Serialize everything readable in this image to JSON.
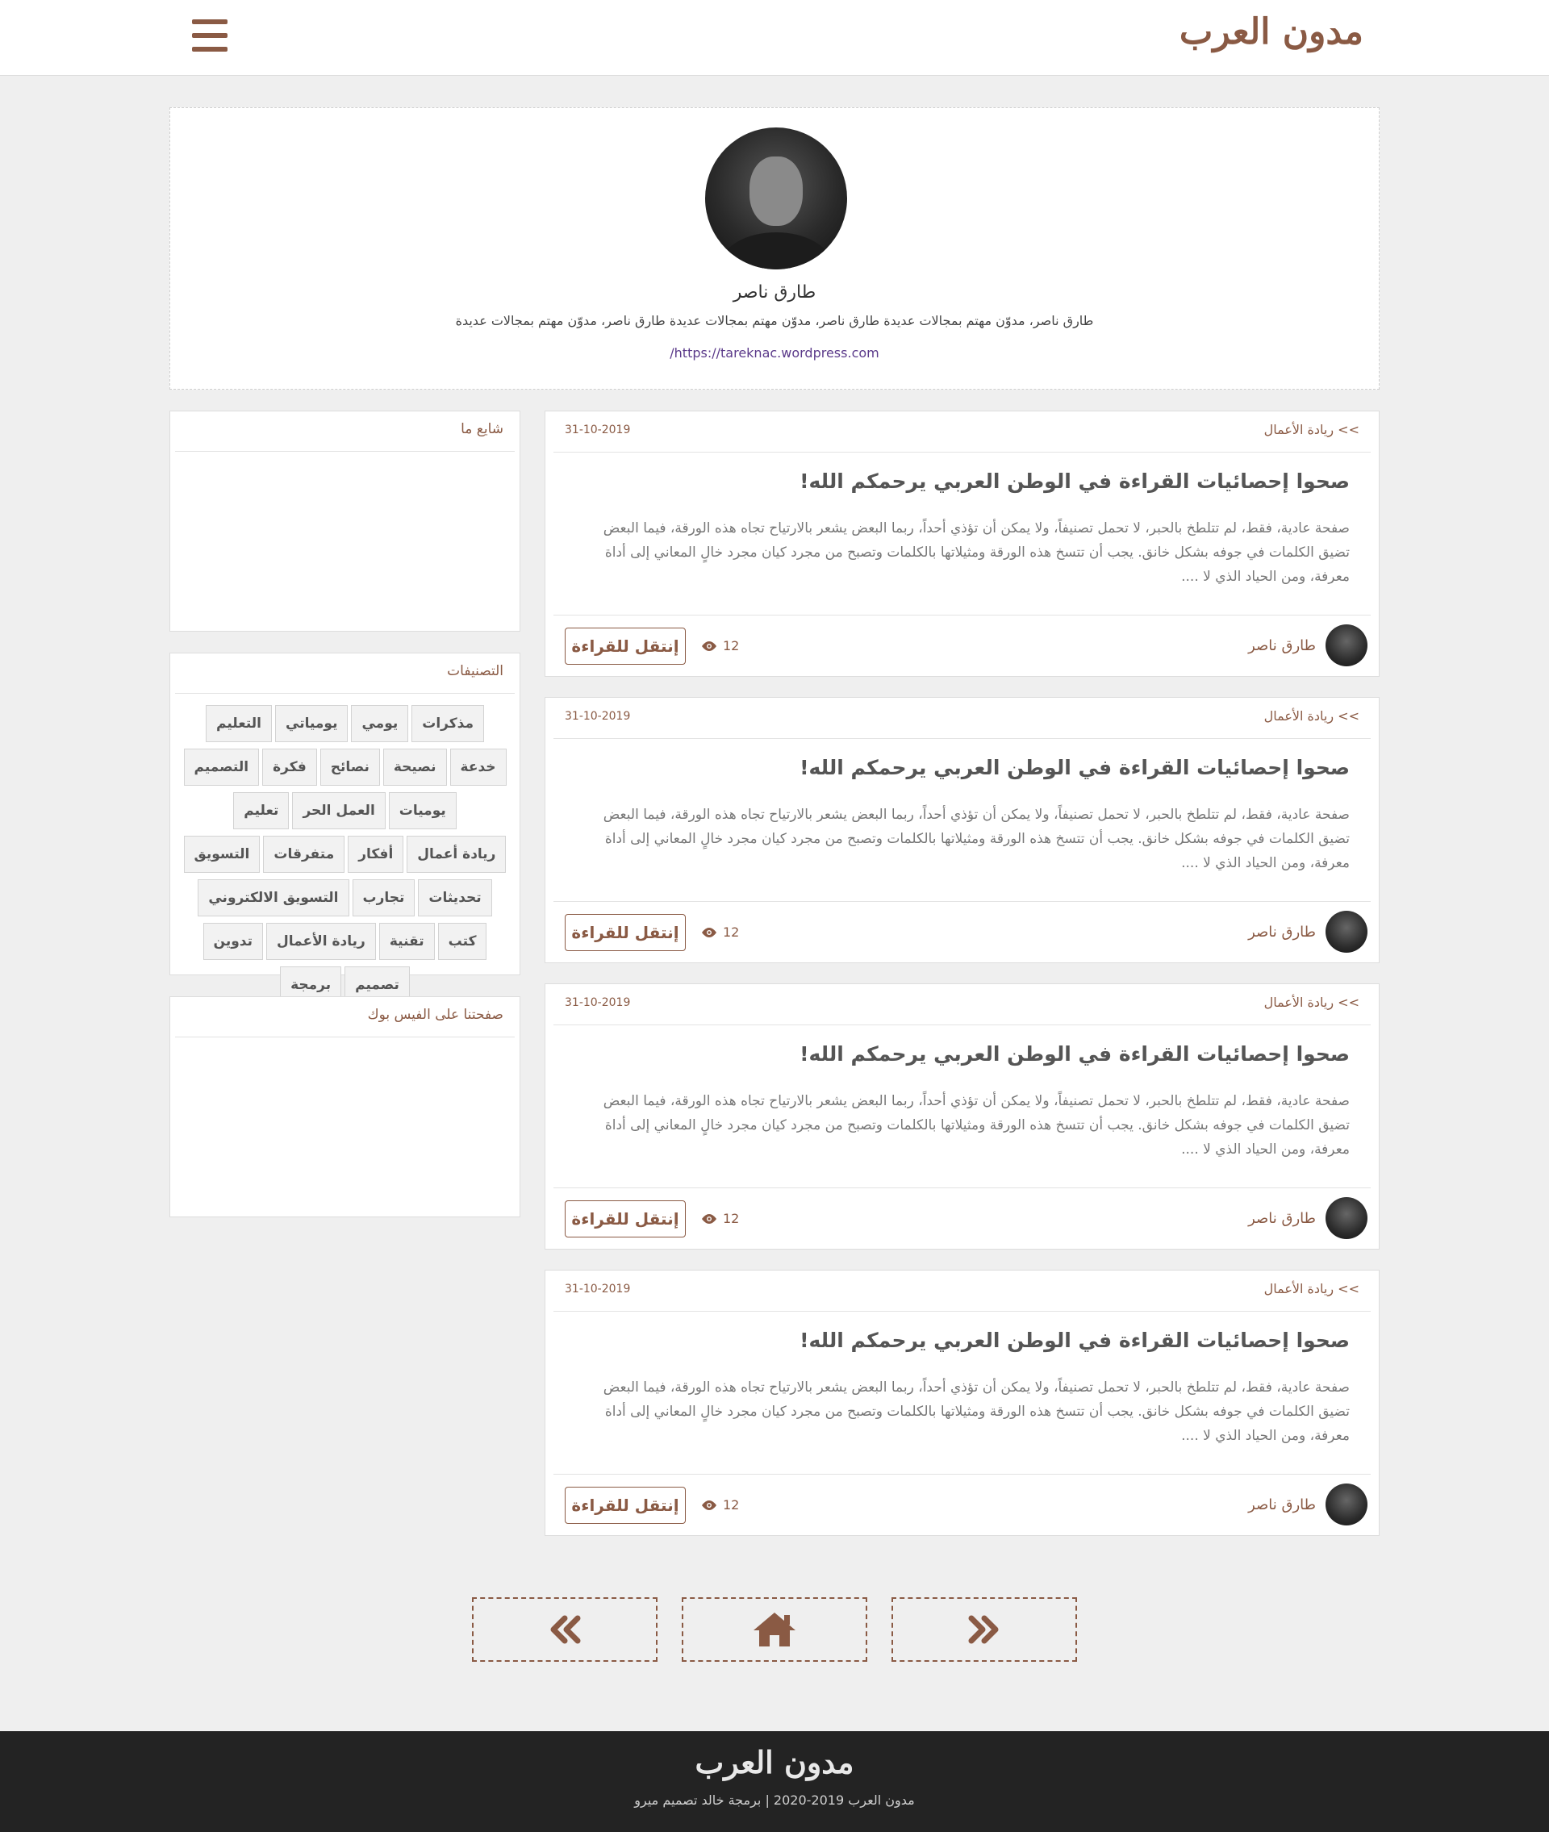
{
  "header": {
    "logo": "مدون العرب",
    "menu_icon": "hamburger-menu-icon"
  },
  "profile": {
    "name": "طارق ناصر",
    "bio": "طارق ناصر، مدوّن مهتم بمجالات عديدة طارق ناصر، مدوّن مهتم بمجالات عديدة طارق ناصر، مدوّن مهتم بمجالات عديدة",
    "link": "https://tareknac.wordpress.com/"
  },
  "posts": [
    {
      "category": ">> ريادة الأعمال",
      "date": "31-10-2019",
      "title": "صحوا إحصائيات القراءة في الوطن العربي يرحمكم الله!",
      "excerpt": "صفحة عادية، فقط، لم تتلطخ بالحبر، لا تحمل تصنيفاً، ولا يمكن أن تؤذي أحداً، ربما البعض يشعر بالارتياح تجاه هذه الورقة، فيما البعض تضيق الكلمات في جوفه بشكل خانق. يجب أن تتسخ هذه الورقة ومثيلاتها بالكلمات وتصبح من مجرد كيان مجرد خالٍ المعاني إلى أداة معرفة، ومن الحياد الذي لا ....",
      "author": "طارق ناصر",
      "views": "12",
      "read_label": "إنتقل للقراءة"
    },
    {
      "category": ">> ريادة الأعمال",
      "date": "31-10-2019",
      "title": "صحوا إحصائيات القراءة في الوطن العربي يرحمكم الله!",
      "excerpt": "صفحة عادية، فقط، لم تتلطخ بالحبر، لا تحمل تصنيفاً، ولا يمكن أن تؤذي أحداً، ربما البعض يشعر بالارتياح تجاه هذه الورقة، فيما البعض تضيق الكلمات في جوفه بشكل خانق. يجب أن تتسخ هذه الورقة ومثيلاتها بالكلمات وتصبح من مجرد كيان مجرد خالٍ المعاني إلى أداة معرفة، ومن الحياد الذي لا ....",
      "author": "طارق ناصر",
      "views": "12",
      "read_label": "إنتقل للقراءة"
    },
    {
      "category": ">> ريادة الأعمال",
      "date": "31-10-2019",
      "title": "صحوا إحصائيات القراءة في الوطن العربي يرحمكم الله!",
      "excerpt": "صفحة عادية، فقط، لم تتلطخ بالحبر، لا تحمل تصنيفاً، ولا يمكن أن تؤذي أحداً، ربما البعض يشعر بالارتياح تجاه هذه الورقة، فيما البعض تضيق الكلمات في جوفه بشكل خانق. يجب أن تتسخ هذه الورقة ومثيلاتها بالكلمات وتصبح من مجرد كيان مجرد خالٍ المعاني إلى أداة معرفة، ومن الحياد الذي لا ....",
      "author": "طارق ناصر",
      "views": "12",
      "read_label": "إنتقل للقراءة"
    },
    {
      "category": ">> ريادة الأعمال",
      "date": "31-10-2019",
      "title": "صحوا إحصائيات القراءة في الوطن العربي يرحمكم الله!",
      "excerpt": "صفحة عادية، فقط، لم تتلطخ بالحبر، لا تحمل تصنيفاً، ولا يمكن أن تؤذي أحداً، ربما البعض يشعر بالارتياح تجاه هذه الورقة، فيما البعض تضيق الكلمات في جوفه بشكل خانق. يجب أن تتسخ هذه الورقة ومثيلاتها بالكلمات وتصبح من مجرد كيان مجرد خالٍ المعاني إلى أداة معرفة، ومن الحياد الذي لا ....",
      "author": "طارق ناصر",
      "views": "12",
      "read_label": "إنتقل للقراءة"
    }
  ],
  "sidebar": {
    "widget1_title": "شايع ما",
    "categories_title": "التصنيفات",
    "categories": [
      "مذكرات",
      "يومي",
      "يومياتي",
      "التعليم",
      "خدعة",
      "نصيحة",
      "نصائح",
      "فكرة",
      "التصميم",
      "يوميات",
      "العمل الحر",
      "تعليم",
      "ريادة أعمال",
      "أفكار",
      "متفرقات",
      "التسويق",
      "تحديثات",
      "تجارب",
      "التسويق الالكتروني",
      "كتب",
      "تقنية",
      "ريادة الأعمال",
      "تدوين",
      "تصميم",
      "برمجة"
    ],
    "facebook_title": "صفحتنا على الفيس بوك"
  },
  "pagination": {
    "prev_icon": "double-chevron-left-icon",
    "home_icon": "home-icon",
    "next_icon": "double-chevron-right-icon"
  },
  "footer": {
    "logo": "مدون العرب",
    "copyright": "مدون العرب 2019-2020 | برمجة خالد تصميم ميرو"
  },
  "colors": {
    "accent": "#8a5a44",
    "background": "#efefef",
    "footer": "#232323"
  }
}
